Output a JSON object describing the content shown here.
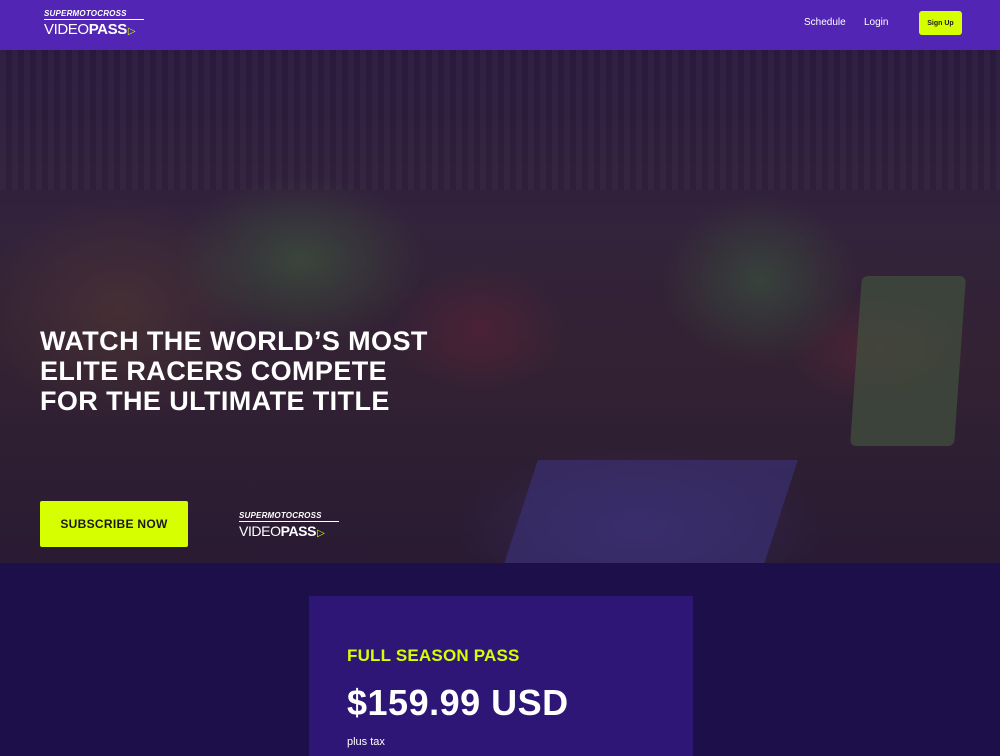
{
  "header": {
    "logo": {
      "line1": "SUPERMOTOCROSS",
      "line2_thin": "VIDEO",
      "line2_bold": "PASS",
      "play_icon": "▷"
    },
    "nav": [
      {
        "label": "Schedule"
      },
      {
        "label": "Login"
      }
    ],
    "signup_label": "Sign Up"
  },
  "hero": {
    "title_lines": [
      "WATCH THE WORLD’S MOST",
      "ELITE RACERS COMPETE",
      "FOR THE ULTIMATE TITLE"
    ],
    "subscribe_label": "SUBSCRIBE NOW",
    "logo": {
      "line1": "SUPERMOTOCROSS",
      "line2_thin": "VIDEO",
      "line2_bold": "PASS",
      "play_icon": "▷"
    }
  },
  "pricing": {
    "plan_name": "FULL SEASON PASS",
    "price": "$159.99 USD",
    "tax_note": "plus tax"
  },
  "colors": {
    "topbar": "#5225b4",
    "accent": "#d6ff00",
    "page_bg": "#1c0f4a",
    "card_bg": "#2e1676"
  }
}
